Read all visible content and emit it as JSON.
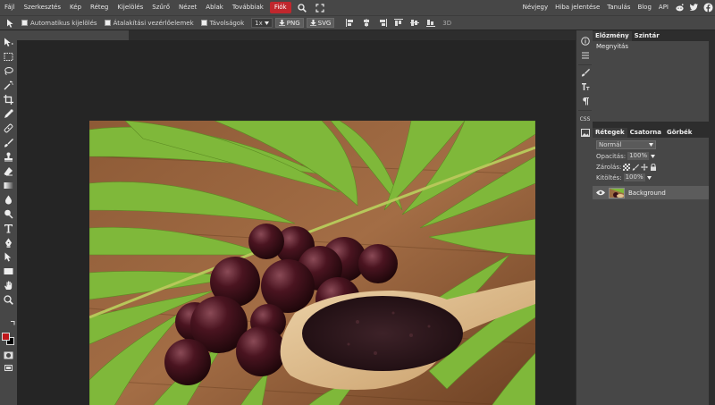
{
  "menu": {
    "items": [
      "Fájl",
      "Szerkesztés",
      "Kép",
      "Réteg",
      "Kijelölés",
      "Szűrő",
      "Nézet",
      "Ablak",
      "Továbbiak"
    ],
    "active": "Fiók",
    "right_links": [
      "Névjegy",
      "Hiba jelentése",
      "Tanulás",
      "Blog",
      "API"
    ],
    "icons": [
      "search-icon",
      "fullscreen-icon"
    ],
    "social": [
      "reddit-icon",
      "twitter-icon",
      "facebook-icon"
    ]
  },
  "options": {
    "auto_select": "Automatikus kijelölés",
    "transform_controls": "Átalakítási vezérlőelemek",
    "distances": "Távolságok",
    "zoom": "1x",
    "png": "PNG",
    "svg": "SVG",
    "threed": "3D"
  },
  "history": {
    "tab_active": "Előzmény",
    "tab_other": "Szintár",
    "items": [
      "Megnyitás"
    ]
  },
  "layers": {
    "tabs": [
      "Rétegek",
      "Csatorna",
      "Görbék"
    ],
    "blend_mode": "Normál",
    "opacity_label": "Opacitás:",
    "opacity_value": "100%",
    "lock_label": "Zárolás:",
    "fill_label": "Kitöltés:",
    "fill_value": "100%",
    "layer_name": "Background"
  },
  "right_column": {
    "css_label": "CSS"
  },
  "colors": {
    "foreground": "#c0161b",
    "background": "#000000",
    "accent": "#c0272d"
  }
}
